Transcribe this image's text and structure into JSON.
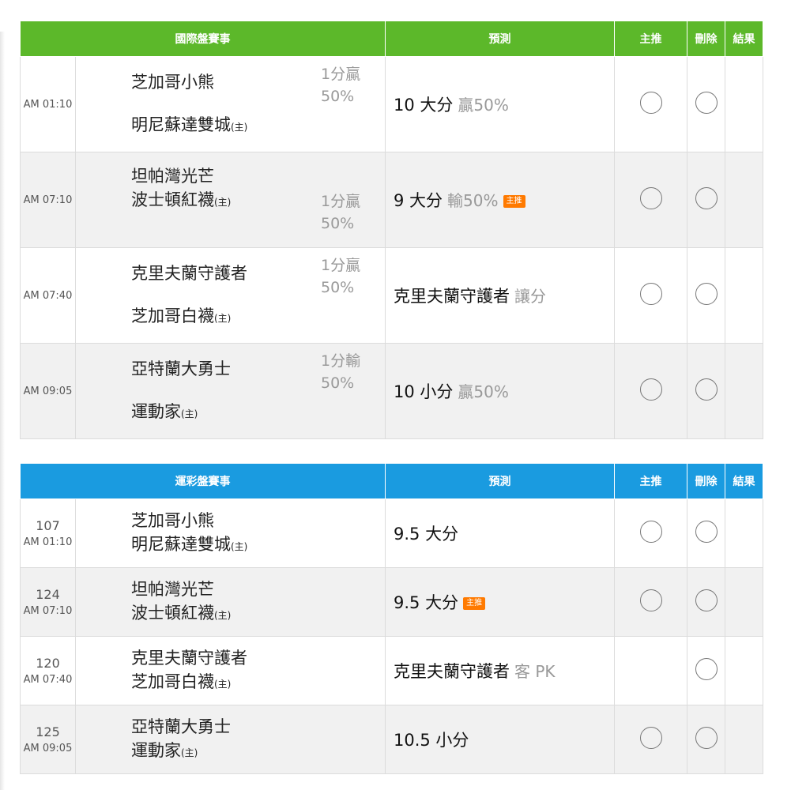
{
  "headers": {
    "intl": "國際盤賽事",
    "lottery": "運彩盤賽事",
    "prediction": "預測",
    "main_pick": "主推",
    "delete": "刪除",
    "result": "結果"
  },
  "home_tag": "(主)",
  "main_badge": "主推",
  "intl_games": [
    {
      "time": "AM 01:10",
      "team1": "芝加哥小熊",
      "team2": "明尼蘇達雙城",
      "spread": "1分贏50%",
      "pick": "10 大分",
      "note": "贏50%",
      "main": false
    },
    {
      "time": "AM 07:10",
      "team1": "坦帕灣光芒",
      "team2": "波士頓紅襪",
      "spread": "1分贏50%",
      "pick": "9 大分",
      "note": "輸50%",
      "main": true
    },
    {
      "time": "AM 07:40",
      "team1": "克里夫蘭守護者",
      "team2": "芝加哥白襪",
      "spread": "1分贏50%",
      "pick": "克里夫蘭守護者",
      "note": "讓分",
      "main": false
    },
    {
      "time": "AM 09:05",
      "team1": "亞特蘭大勇士",
      "team2": "運動家",
      "spread": "1分輸50%",
      "pick": "10 小分",
      "note": "贏50%",
      "main": false
    }
  ],
  "lottery_games": [
    {
      "code": "107",
      "time": "AM 01:10",
      "team1": "芝加哥小熊",
      "team2": "明尼蘇達雙城",
      "pick": "9.5 大分",
      "note": "",
      "main": false
    },
    {
      "code": "124",
      "time": "AM 07:10",
      "team1": "坦帕灣光芒",
      "team2": "波士頓紅襪",
      "pick": "9.5 大分",
      "note": "",
      "main": true
    },
    {
      "code": "120",
      "time": "AM 07:40",
      "team1": "克里夫蘭守護者",
      "team2": "芝加哥白襪",
      "pick": "克里夫蘭守護者",
      "note": "客 PK",
      "main": false
    },
    {
      "code": "125",
      "time": "AM 09:05",
      "team1": "亞特蘭大勇士",
      "team2": "運動家",
      "pick": "10.5 小分",
      "note": "",
      "main": false
    }
  ]
}
